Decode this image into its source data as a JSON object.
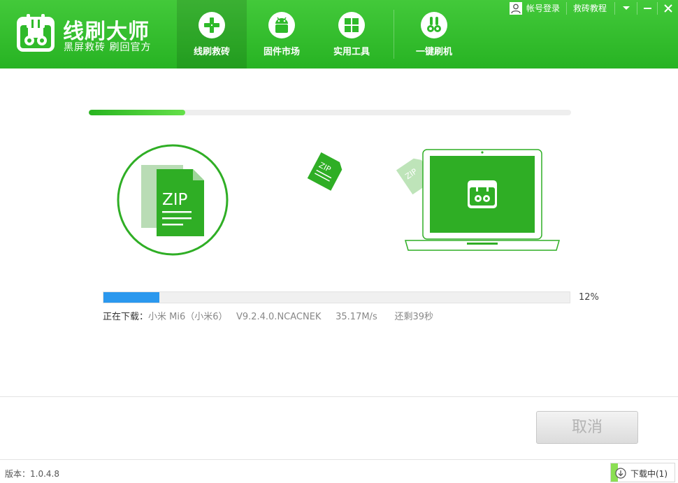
{
  "app": {
    "title": "线刷大师",
    "slogan": "黑屏救砖 刷回官方",
    "brand_color": "#2fba2a"
  },
  "nav": {
    "tabs": [
      {
        "label": "线刷救砖",
        "icon": "cross-icon",
        "active": true
      },
      {
        "label": "固件市场",
        "icon": "android-icon",
        "active": false
      },
      {
        "label": "实用工具",
        "icon": "grid-icon",
        "active": false
      },
      {
        "label": "一键刷机",
        "icon": "rabbit-icon",
        "active": false
      }
    ]
  },
  "topbar": {
    "login_label": "帐号登录",
    "tutorial_label": "救砖教程"
  },
  "progress": {
    "stage_fraction": 0.2,
    "download_percent_value": 12,
    "download_percent_label": "12%",
    "fill_color": "#2b98ee"
  },
  "illustration": {
    "file_label": "ZIP"
  },
  "status": {
    "state_label": "正在下载：",
    "device": "小米 Mi6（小米6）",
    "firmware": "V9.2.4.0.NCACNEK",
    "speed": "35.17M/s",
    "remaining": "还剩39秒"
  },
  "actions": {
    "cancel_label": "取消"
  },
  "footer": {
    "version": "版本：1.0.4.8",
    "download_status": "下载中(1)"
  }
}
